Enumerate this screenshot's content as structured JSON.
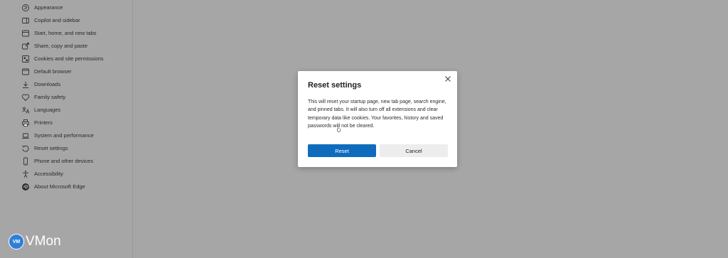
{
  "sidebar": {
    "items": [
      {
        "label": "Appearance",
        "icon": "appearance-icon"
      },
      {
        "label": "Copilot and sidebar",
        "icon": "sidebar-icon"
      },
      {
        "label": "Start, home, and new tabs",
        "icon": "home-icon"
      },
      {
        "label": "Share, copy and paste",
        "icon": "share-icon"
      },
      {
        "label": "Cookies and site permissions",
        "icon": "cookie-icon"
      },
      {
        "label": "Default browser",
        "icon": "browser-icon"
      },
      {
        "label": "Downloads",
        "icon": "download-icon"
      },
      {
        "label": "Family safety",
        "icon": "family-icon"
      },
      {
        "label": "Languages",
        "icon": "language-icon"
      },
      {
        "label": "Printers",
        "icon": "printer-icon"
      },
      {
        "label": "System and performance",
        "icon": "laptop-icon"
      },
      {
        "label": "Reset settings",
        "icon": "reset-icon"
      },
      {
        "label": "Phone and other devices",
        "icon": "phone-icon"
      },
      {
        "label": "Accessibility",
        "icon": "accessibility-icon"
      },
      {
        "label": "About Microsoft Edge",
        "icon": "edge-logo-icon"
      }
    ]
  },
  "dialog": {
    "title": "Reset settings",
    "body": "This will reset your startup page, new tab page, search engine, and pinned tabs. It will also turn off all extensions and clear temporary data like cookies. Your favorites, history and saved passwords will not be cleared.",
    "primary_label": "Reset",
    "secondary_label": "Cancel"
  },
  "watermark": {
    "badge": "VM",
    "text": "VMon"
  },
  "colors": {
    "overlay": "#a6a6a6",
    "primary_button": "#0f6cbd",
    "secondary_button": "#ededed"
  }
}
